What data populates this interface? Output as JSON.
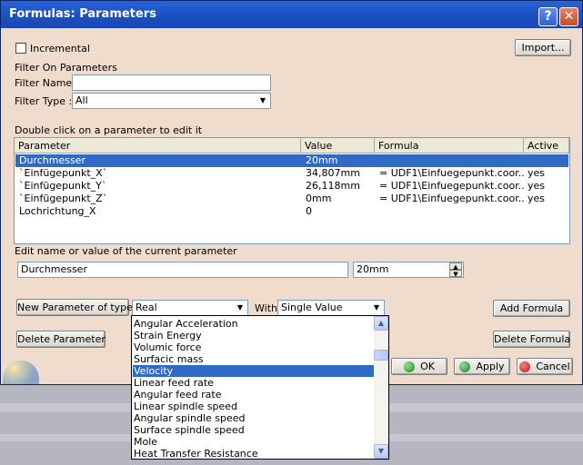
{
  "window": {
    "title": "Formulas: Parameters",
    "help_label": "?",
    "close_label": "✕"
  },
  "top": {
    "incremental_label": "Incremental",
    "incremental_checked": false,
    "import_label": "Import...",
    "filter_header": "Filter On Parameters",
    "filter_name_label": "Filter Name :",
    "filter_name_value": "",
    "filter_type_label": "Filter Type :",
    "filter_type_value": "All"
  },
  "table": {
    "hint": "Double click on a parameter to edit it",
    "columns": [
      "Parameter",
      "Value",
      "Formula",
      "Active"
    ],
    "rows": [
      {
        "parameter": "Durchmesser",
        "value": "20mm",
        "formula": "",
        "active": "",
        "selected": true
      },
      {
        "parameter": "`Einfügepunkt_X`",
        "value": "34,807mm",
        "formula": "= UDF1\\Einfuegepunkt.coor...",
        "active": "yes",
        "selected": false
      },
      {
        "parameter": "`Einfügepunkt_Y`",
        "value": "26,118mm",
        "formula": "= UDF1\\Einfuegepunkt.coor...",
        "active": "yes",
        "selected": false
      },
      {
        "parameter": "`Einfügepunkt_Z`",
        "value": "0mm",
        "formula": "= UDF1\\Einfuegepunkt.coor...",
        "active": "yes",
        "selected": false
      },
      {
        "parameter": "Lochrichtung_X",
        "value": "0",
        "formula": "",
        "active": "",
        "selected": false
      }
    ]
  },
  "edit": {
    "label": "Edit name or value of the current parameter",
    "name_value": "Durchmesser",
    "value_value": "20mm"
  },
  "new_param": {
    "button_label": "New Parameter of type",
    "type_value": "Real",
    "with_label": "With",
    "with_value": "Single Value",
    "add_formula_label": "Add Formula",
    "delete_parameter_label": "Delete Parameter",
    "delete_formula_label": "Delete Formula"
  },
  "dropdown_items": [
    "Angular Acceleration",
    "Strain Energy",
    "Volumic force",
    "Surfacic mass",
    "Velocity",
    "Linear feed rate",
    "Angular feed rate",
    "Linear spindle speed",
    "Angular spindle speed",
    "Surface spindle speed",
    "Mole",
    "Heat Transfer Resistance"
  ],
  "dropdown_selected": "Velocity",
  "footer": {
    "ok_label": "OK",
    "apply_label": "Apply",
    "cancel_label": "Cancel"
  },
  "colors": {
    "dialog_bg": "#f0dccc",
    "titlebar": "#1d55c6",
    "selection": "#316ac5"
  }
}
